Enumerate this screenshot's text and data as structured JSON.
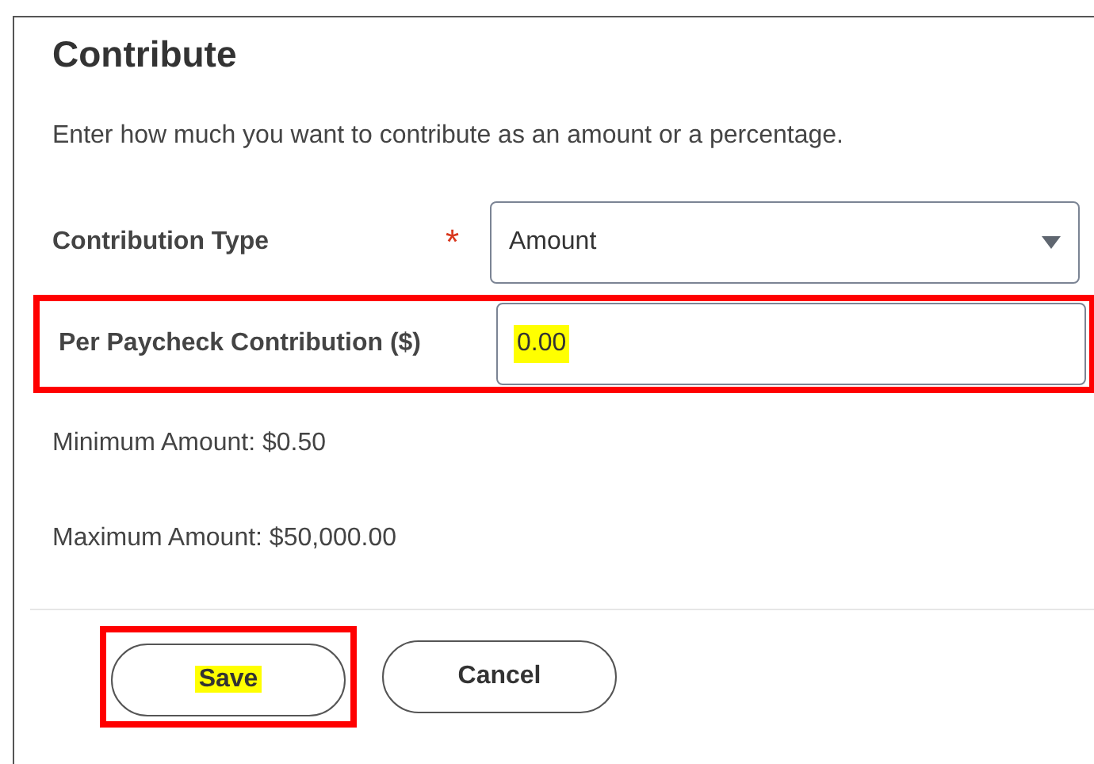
{
  "title": "Contribute",
  "description": "Enter how much you want to contribute as an amount or a percentage.",
  "fields": [
    {
      "kind": "select",
      "label": "Contribution Type",
      "required_mark": "*",
      "value": "Amount",
      "annotated": false,
      "highlighted": false
    },
    {
      "kind": "input",
      "label": "Per Paycheck Contribution ($)",
      "value": "0.00",
      "annotated": true,
      "highlighted": true
    }
  ],
  "limits": [
    "Minimum Amount: $0.50",
    "Maximum Amount: $50,000.00"
  ],
  "buttons": [
    {
      "label": "Save",
      "annotated": true,
      "highlighted": true
    },
    {
      "label": "Cancel",
      "annotated": false,
      "highlighted": false
    }
  ]
}
